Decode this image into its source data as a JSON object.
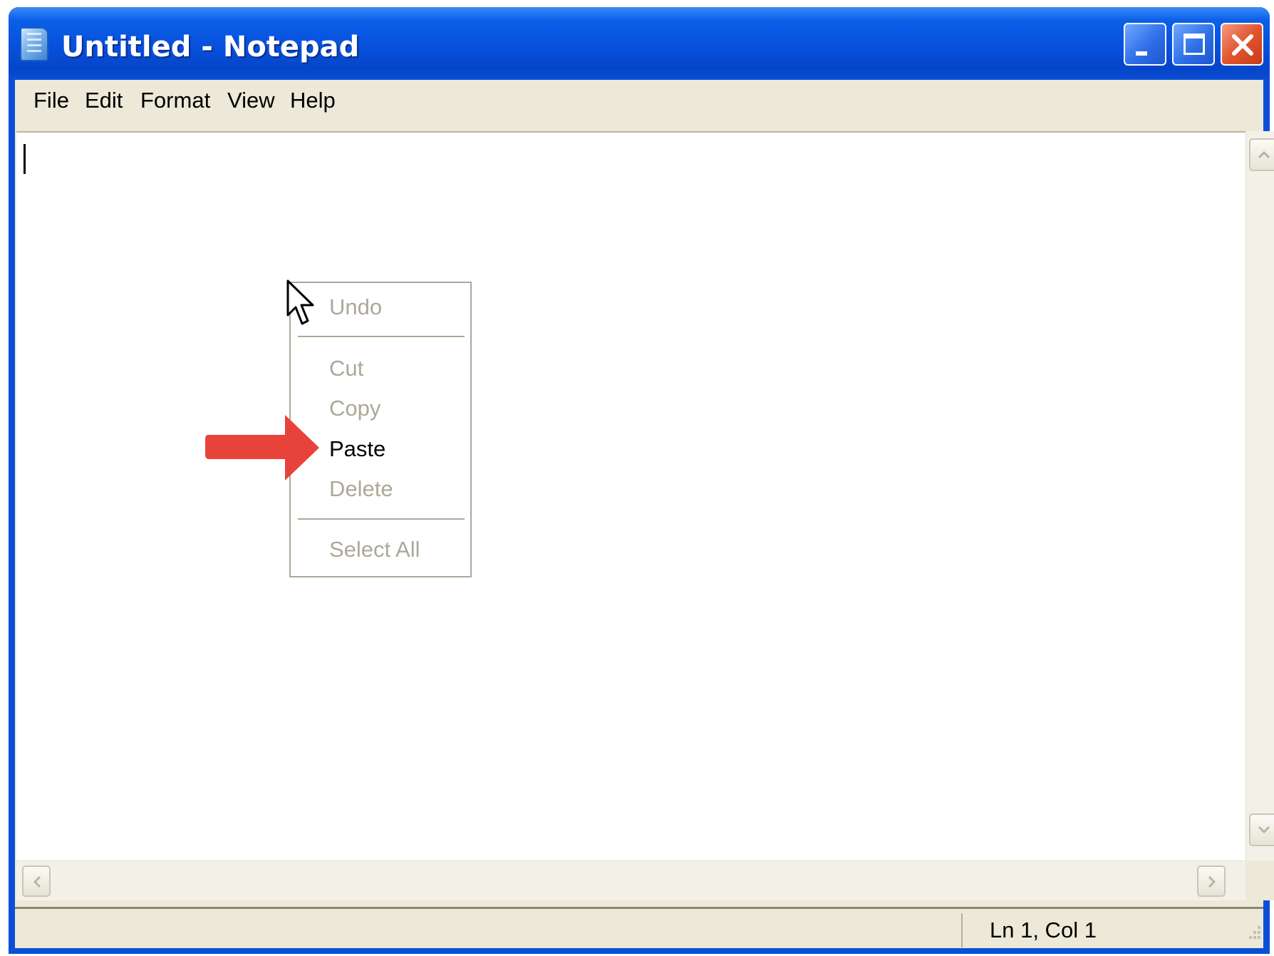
{
  "window": {
    "title": "Untitled - Notepad",
    "icon": "notepad-icon",
    "controls": [
      "minimize-icon",
      "maximize-icon",
      "close-icon"
    ]
  },
  "menubar": {
    "items": [
      {
        "label": "File"
      },
      {
        "label": "Edit"
      },
      {
        "label": "Format"
      },
      {
        "label": "View"
      },
      {
        "label": "Help"
      }
    ]
  },
  "editor": {
    "content": ""
  },
  "context_menu": {
    "items": [
      {
        "label": "Undo",
        "enabled": false
      },
      {
        "label": "Cut",
        "enabled": false
      },
      {
        "label": "Copy",
        "enabled": false
      },
      {
        "label": "Paste",
        "enabled": true
      },
      {
        "label": "Delete",
        "enabled": false
      },
      {
        "label": "Select All",
        "enabled": false
      }
    ]
  },
  "annotation": {
    "arrow_color": "#e8433b",
    "points_to": "Paste"
  },
  "statusbar": {
    "position": "Ln 1, Col 1"
  },
  "colors": {
    "titlebar": "#0750dc",
    "close_button": "#e2552f",
    "menu_face": "#ece9d8"
  }
}
